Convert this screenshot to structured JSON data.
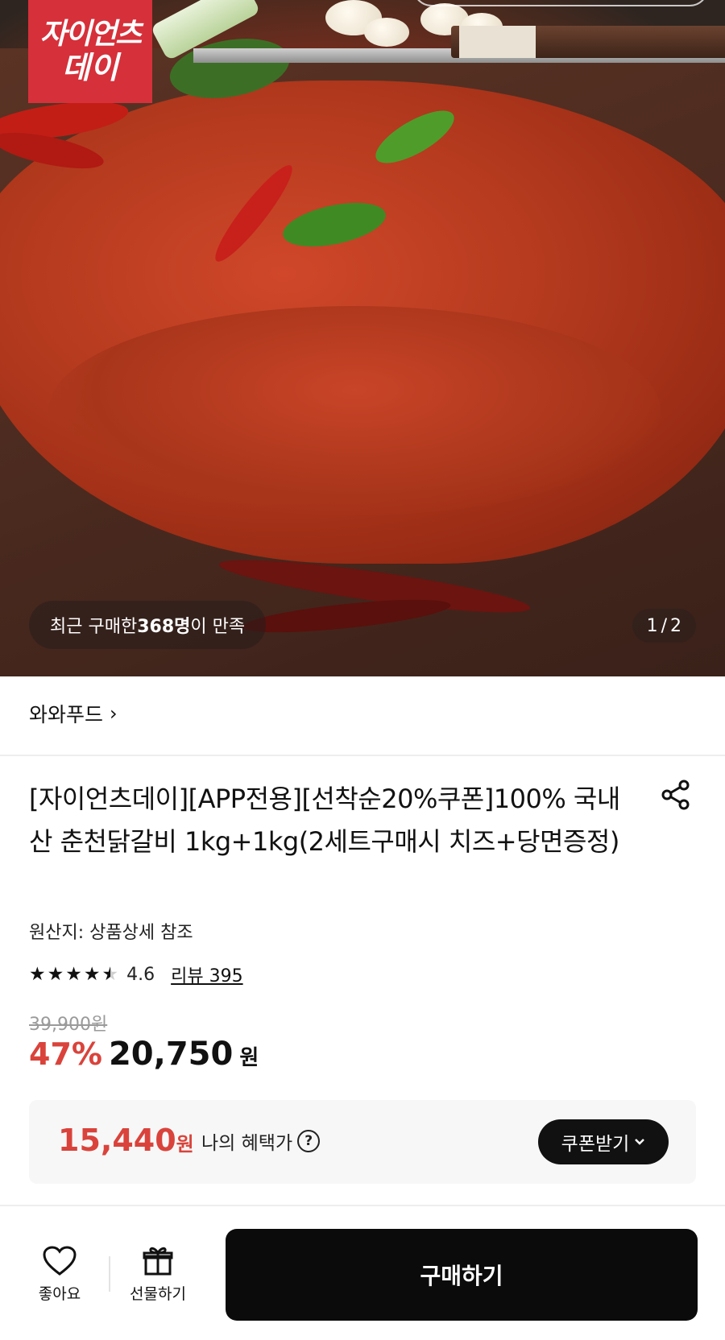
{
  "hero": {
    "logo_line1": "자이언츠",
    "logo_line2": "데이",
    "satisfaction_prefix": "최근 구매한 ",
    "satisfaction_count": "368명",
    "satisfaction_suffix": "이 만족",
    "pager_current": "1",
    "pager_separator": "/",
    "pager_total": "2"
  },
  "brand": {
    "name": "와와푸드",
    "chevron": "›"
  },
  "product": {
    "title": "[자이언츠데이][APP전용][선착순20%쿠폰]100% 국내산 춘천닭갈비 1kg+1kg(2세트구매시 치즈+당면증정)",
    "origin": "원산지: 상품상세 참조",
    "rating": "4.6",
    "rating_stars": 4.6,
    "review_label": "리뷰 395",
    "original_price": "39,900원",
    "discount": "47%",
    "price": "20,750",
    "price_unit": "원"
  },
  "benefit": {
    "price": "15,440",
    "unit": "원",
    "label": "나의 혜택가",
    "help_icon": "?",
    "coupon_button": "쿠폰받기",
    "coupon_chevron": "⌄"
  },
  "bottom_bar": {
    "like_label": "좋아요",
    "gift_label": "선물하기",
    "buy_label": "구매하기"
  },
  "colors": {
    "accent_red": "#d9433b",
    "button_black": "#0b0b0b",
    "benefit_bg": "#f7f7f7",
    "logo_red": "#d6303a"
  },
  "icons": {
    "share": "share-icon",
    "heart": "heart-icon",
    "gift": "gift-icon",
    "star": "star-icon",
    "question": "question-icon"
  }
}
